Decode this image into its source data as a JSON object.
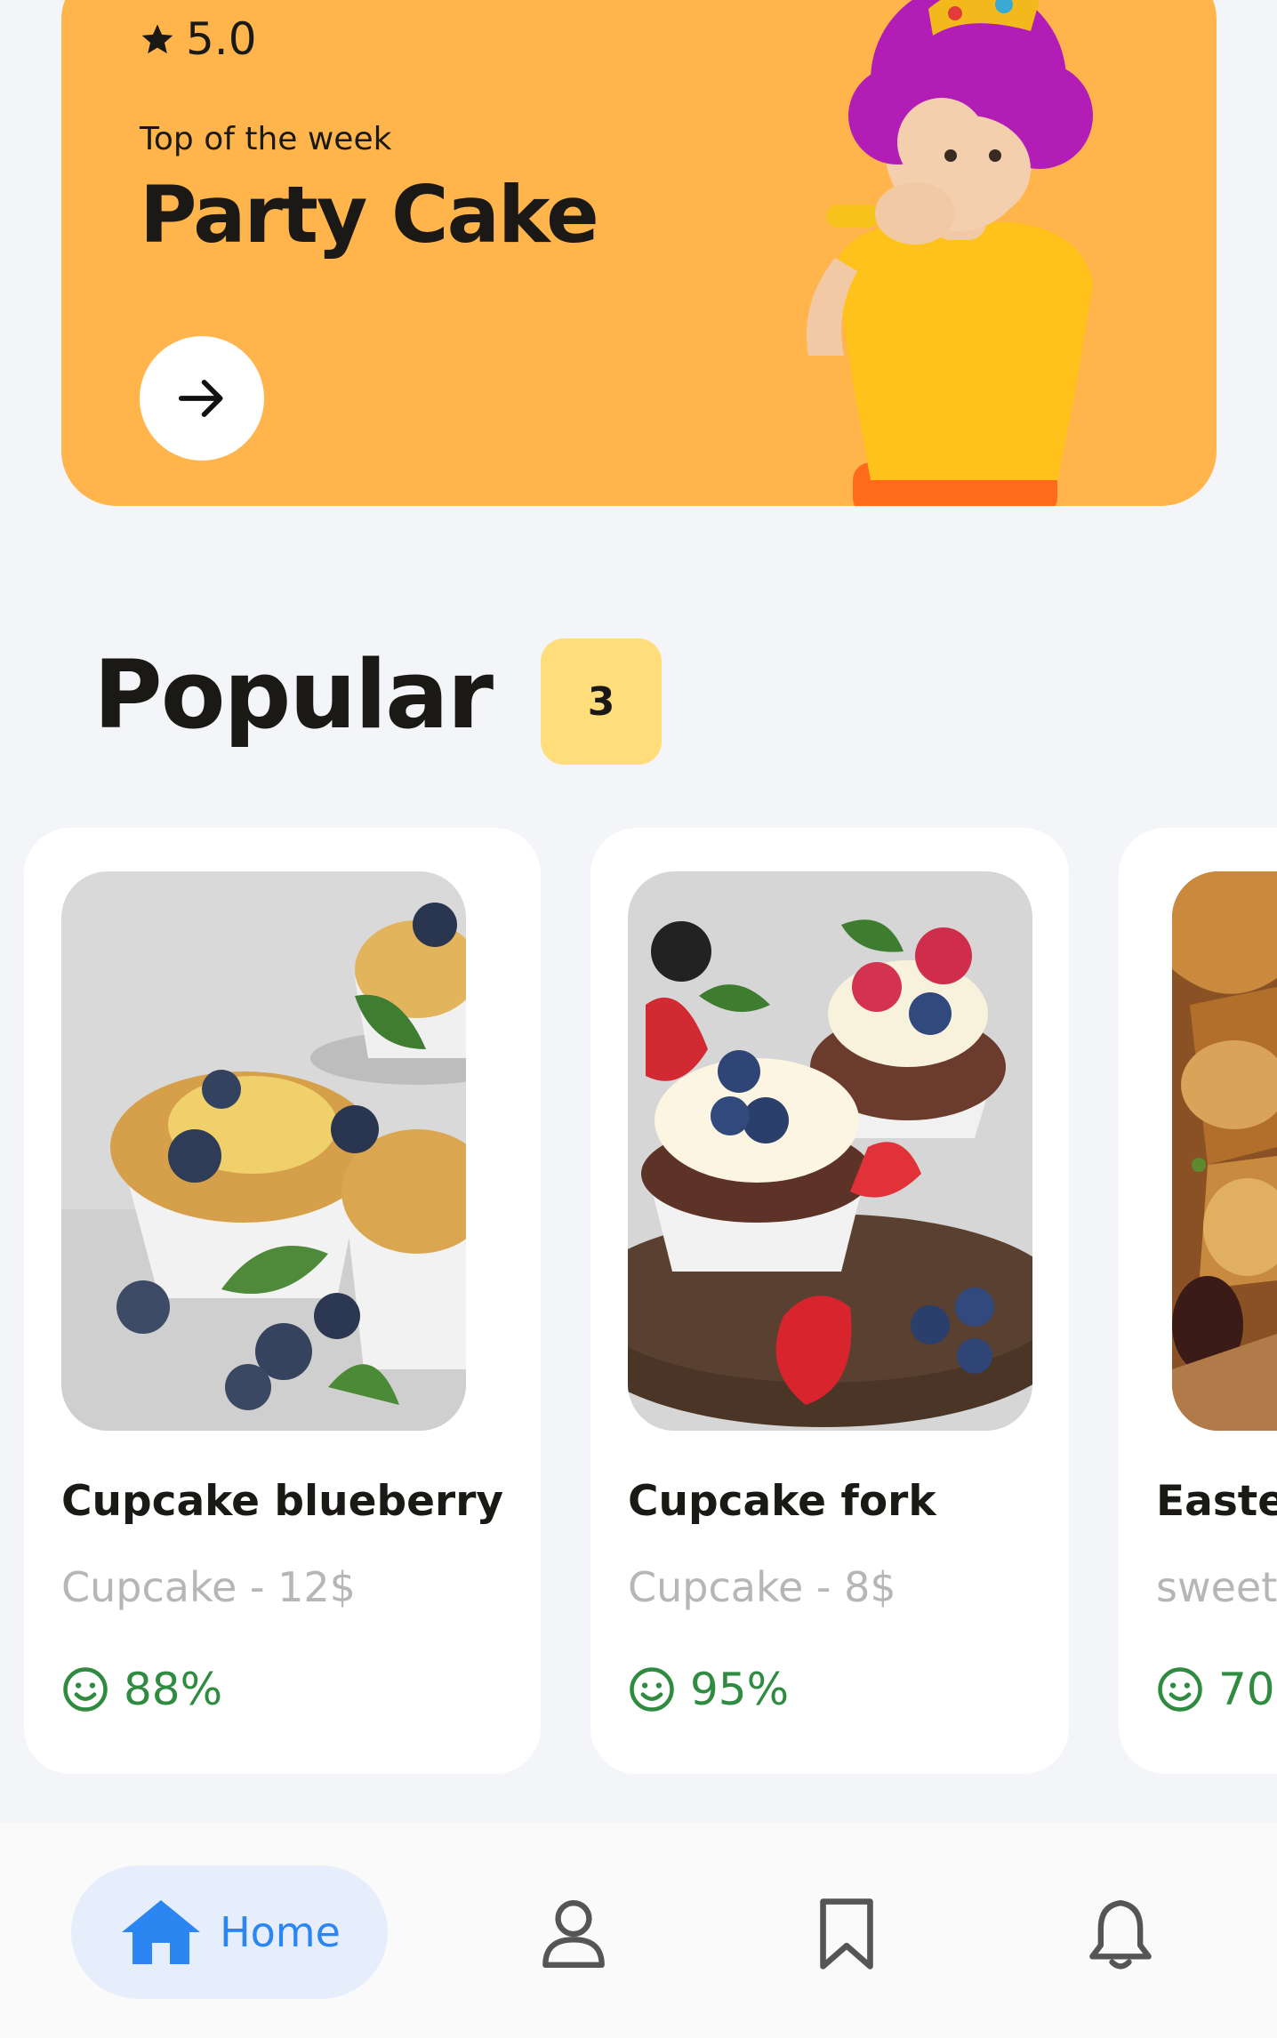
{
  "hero": {
    "rating": "5.0",
    "subtitle": "Top of the week",
    "title": "Party Cake"
  },
  "popular": {
    "title": "Popular",
    "count": "3"
  },
  "cards": [
    {
      "name": "Cupcake blueberry",
      "category": "Cupcake - 12$",
      "score": "88%"
    },
    {
      "name": "Cupcake fork",
      "category": "Cupcake - 8$",
      "score": "95%"
    },
    {
      "name": "Easte",
      "category": "sweet",
      "score": "70"
    }
  ],
  "nav": {
    "home_label": "Home"
  },
  "colors": {
    "hero_bg": "#ffb54c",
    "badge_bg": "#ffdd7a",
    "accent_blue": "#2c86f1",
    "score_green": "#2e8b3f"
  }
}
